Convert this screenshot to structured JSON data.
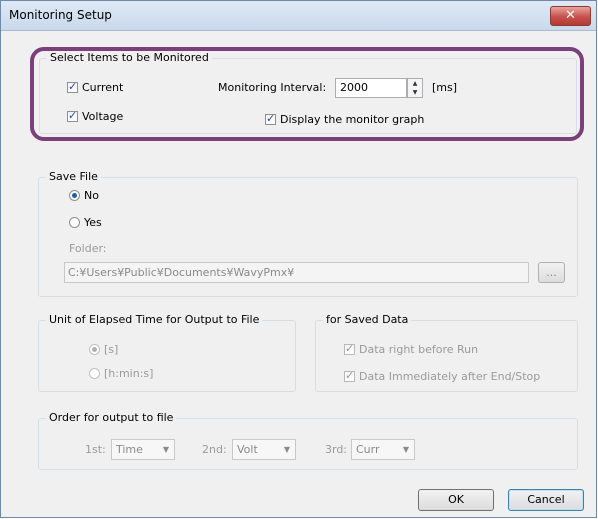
{
  "window": {
    "title": "Monitoring Setup",
    "close_glyph": "✕"
  },
  "select_items": {
    "legend": "Select Items to be Monitored",
    "current_label": "Current",
    "voltage_label": "Voltage",
    "interval_label": "Monitoring Interval:",
    "interval_value": "2000",
    "interval_unit": "[ms]",
    "graph_label": "Display the monitor graph",
    "current_checked": true,
    "voltage_checked": true,
    "graph_checked": true
  },
  "save_file": {
    "legend": "Save File",
    "no_label": "No",
    "yes_label": "Yes",
    "folder_label": "Folder:",
    "folder_value": "C:¥Users¥Public¥Documents¥WavyPmx¥",
    "browse_label": "..."
  },
  "elapsed": {
    "legend": "Unit of Elapsed Time for Output to File",
    "s_label": "[s]",
    "hms_label": "[h:min:s]"
  },
  "saved_data": {
    "legend": "for Saved Data",
    "before_label": "Data right before Run",
    "after_label": "Data Immediately after End/Stop"
  },
  "order": {
    "legend": "Order for output to file",
    "first_label": "1st:",
    "first_value": "Time",
    "second_label": "2nd:",
    "second_value": "Volt",
    "third_label": "3rd:",
    "third_value": "Curr"
  },
  "buttons": {
    "ok": "OK",
    "cancel": "Cancel"
  },
  "colors": {
    "highlight": "#7b3f7b",
    "close": "#c75050",
    "radio_dot": "#1c5fb8"
  }
}
